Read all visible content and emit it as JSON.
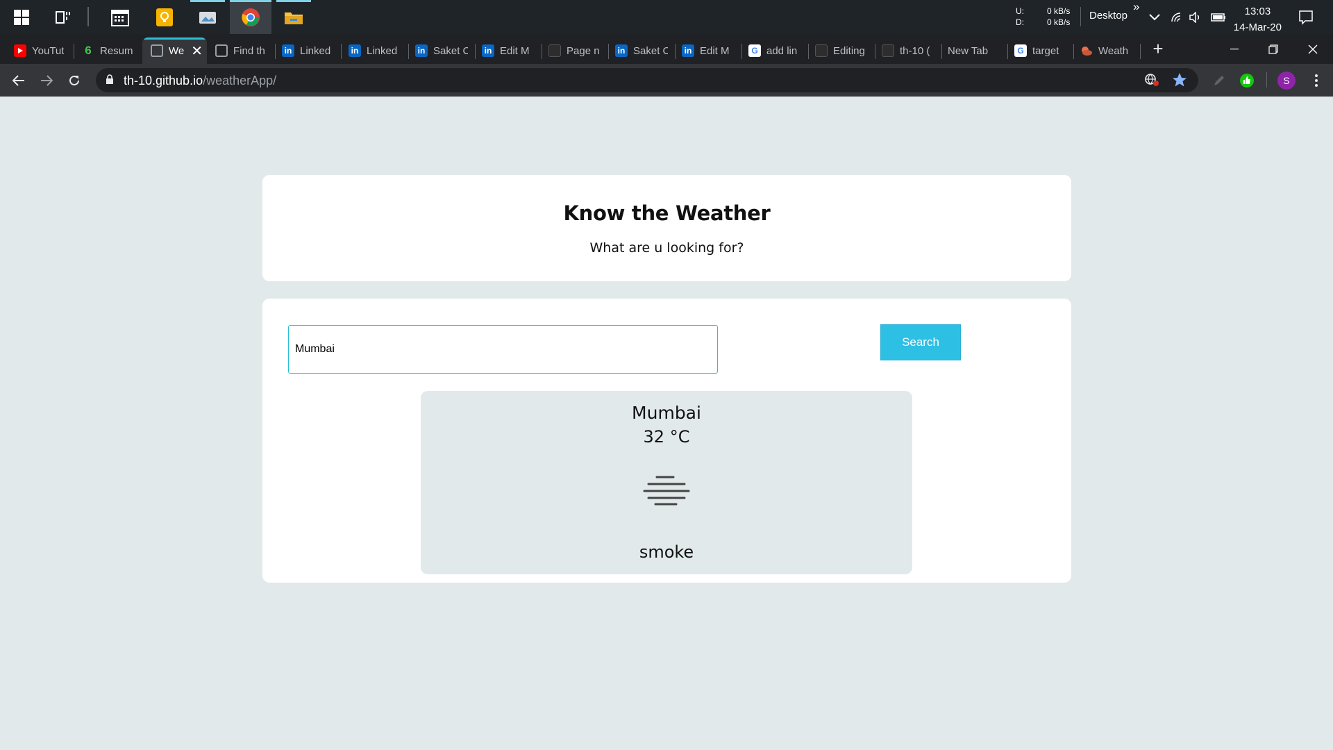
{
  "taskbar": {
    "network_up_label": "U:",
    "network_up_value": "0 kB/s",
    "network_down_label": "D:",
    "network_down_value": "0 kB/s",
    "desktop_label": "Desktop",
    "overflow_glyph": "»",
    "time": "13:03",
    "date": "14-Mar-20"
  },
  "tabs": [
    {
      "label": "YouTut",
      "favicon": "youtube-icon"
    },
    {
      "label": "Resum",
      "favicon": "resume-icon"
    },
    {
      "label": "We",
      "favicon": "globe-icon",
      "active": true
    },
    {
      "label": "Find th",
      "favicon": "globe-icon"
    },
    {
      "label": "Linked",
      "favicon": "linkedin-icon"
    },
    {
      "label": "Linked",
      "favicon": "linkedin-icon"
    },
    {
      "label": "Saket C",
      "favicon": "linkedin-icon"
    },
    {
      "label": "Edit M",
      "favicon": "linkedin-icon"
    },
    {
      "label": "Page n",
      "favicon": "github-icon"
    },
    {
      "label": "Saket C",
      "favicon": "linkedin-icon"
    },
    {
      "label": "Edit M",
      "favicon": "linkedin-icon"
    },
    {
      "label": "add lin",
      "favicon": "google-icon"
    },
    {
      "label": "Editing",
      "favicon": "github-icon"
    },
    {
      "label": "th-10 (",
      "favicon": "github-icon"
    },
    {
      "label": "New Tab",
      "favicon": ""
    },
    {
      "label": "target",
      "favicon": "google-icon"
    },
    {
      "label": "Weath",
      "favicon": "weather-icon"
    }
  ],
  "browser": {
    "url_host": "th-10.github.io",
    "url_path": "/weatherApp/",
    "profile_initial": "S",
    "accent_color": "#2bc0d6"
  },
  "app": {
    "title": "Know the Weather",
    "subtitle": "What are u looking for?",
    "search_value": "Mumbai",
    "search_button": "Search",
    "result": {
      "city": "Mumbai",
      "temperature": "32 °C",
      "condition_icon": "fog-smoke-icon",
      "description": "smoke"
    },
    "button_color": "#2ebfe4",
    "background_color": "#e2e9eb"
  }
}
